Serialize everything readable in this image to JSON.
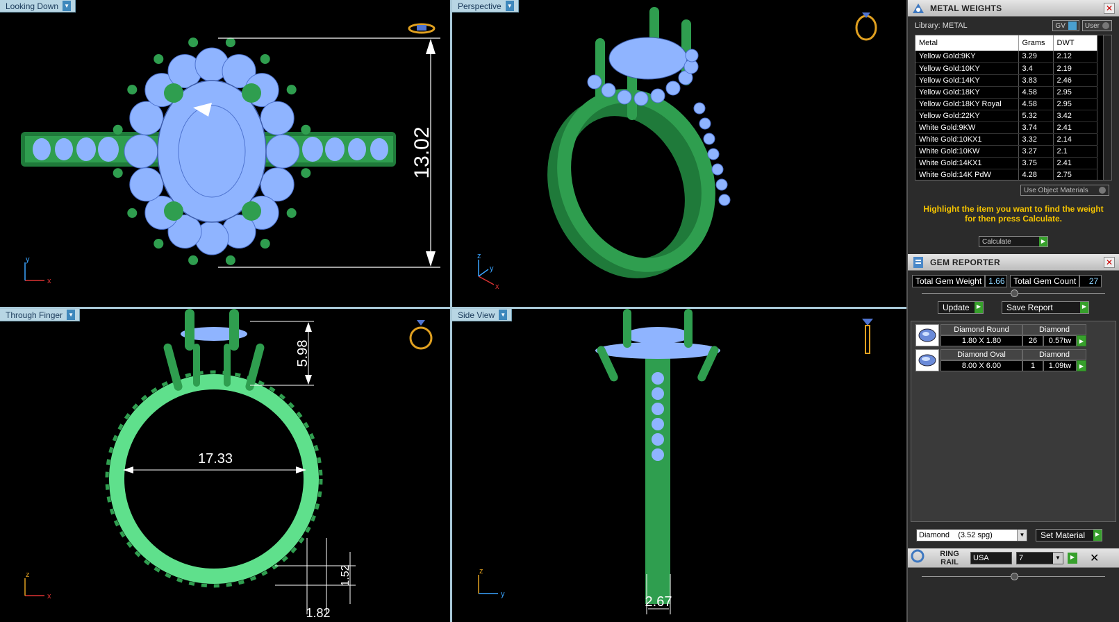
{
  "viewports": {
    "top": {
      "label": "Looking Down",
      "dim": "13.02"
    },
    "perspective": {
      "label": "Perspective"
    },
    "front": {
      "label": "Through Finger",
      "dim_height": "5.98",
      "dim_inner": "17.33",
      "dim_small": "1.52",
      "dim_bottom": "1.82"
    },
    "side": {
      "label": "Side View",
      "dim_width": "2.67"
    }
  },
  "axes": {
    "x": "x",
    "y": "y",
    "z": "z"
  },
  "colors": {
    "metal": "#2f9e4f",
    "metal_light": "#5fe08c",
    "gem": "#8fb4ff",
    "gem_dark": "#4f74d0",
    "dim": "#ffffff",
    "accent": "#f5c400"
  },
  "metal_weights": {
    "title": "METAL WEIGHTS",
    "library_label": "Library: METAL",
    "gv_label": "GV",
    "user_label": "User",
    "columns": [
      "Metal",
      "Grams",
      "DWT"
    ],
    "rows": [
      [
        "Yellow Gold:9KY",
        "3.29",
        "2.12"
      ],
      [
        "Yellow Gold:10KY",
        "3.4",
        "2.19"
      ],
      [
        "Yellow Gold:14KY",
        "3.83",
        "2.46"
      ],
      [
        "Yellow Gold:18KY",
        "4.58",
        "2.95"
      ],
      [
        "Yellow Gold:18KY Royal",
        "4.58",
        "2.95"
      ],
      [
        "Yellow Gold:22KY",
        "5.32",
        "3.42"
      ],
      [
        "White Gold:9KW",
        "3.74",
        "2.41"
      ],
      [
        "White Gold:10KX1",
        "3.32",
        "2.14"
      ],
      [
        "White Gold:10KW",
        "3.27",
        "2.1"
      ],
      [
        "White Gold:14KX1",
        "3.75",
        "2.41"
      ],
      [
        "White Gold:14K PdW",
        "4.28",
        "2.75"
      ]
    ],
    "use_object_materials": "Use Object Materials",
    "hint": "Highlight the item you want to find the weight for then press Calculate.",
    "calculate": "Calculate"
  },
  "gem_reporter": {
    "title": "GEM REPORTER",
    "total_weight_label": "Total Gem Weight",
    "total_weight": "1.66",
    "total_count_label": "Total Gem Count",
    "total_count": "27",
    "update": "Update",
    "save_report": "Save Report",
    "gems": [
      {
        "name": "Diamond Round",
        "type": "Diamond",
        "size": "1.80 X 1.80",
        "count": "26",
        "weight": "0.57tw"
      },
      {
        "name": "Diamond Oval",
        "type": "Diamond",
        "size": "8.00 X 6.00",
        "count": "1",
        "weight": "1.09tw"
      }
    ],
    "material": "Diamond    (3.52 spg)",
    "set_material": "Set Material"
  },
  "ring_rail": {
    "title_line1": "RING",
    "title_line2": "RAIL",
    "standard": "USA",
    "size": "7"
  }
}
